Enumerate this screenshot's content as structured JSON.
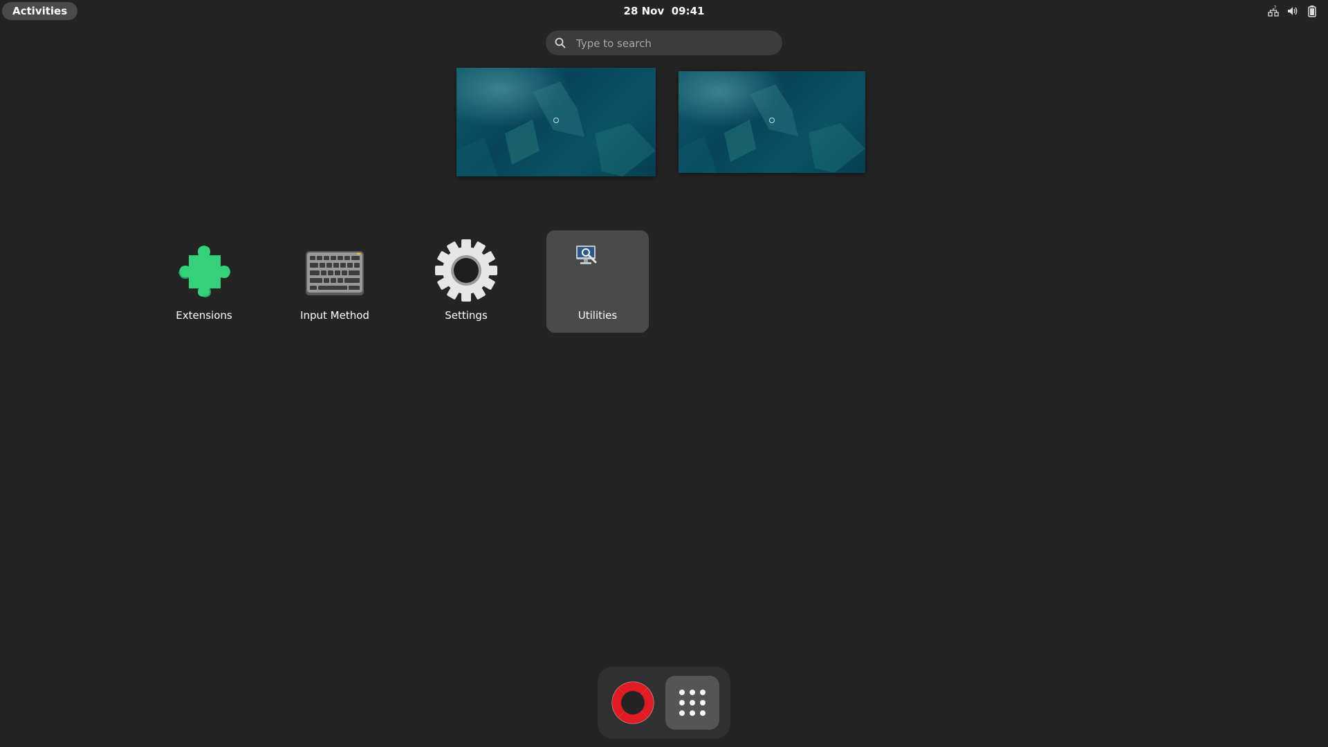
{
  "topbar": {
    "activities_label": "Activities",
    "clock": "28 Nov  09:41",
    "tray_icons": [
      "network-icon",
      "volume-icon",
      "battery-icon"
    ]
  },
  "search": {
    "placeholder": "Type to search",
    "value": ""
  },
  "workspaces": [
    {
      "name": "workspace-1"
    },
    {
      "name": "workspace-2"
    }
  ],
  "apps": [
    {
      "label": "Extensions",
      "icon": "puzzle-piece-icon",
      "color": "#33d17a"
    },
    {
      "label": "Input Method",
      "icon": "keyboard-icon",
      "color": "#9a9a9a"
    },
    {
      "label": "Settings",
      "icon": "gear-icon",
      "color": "#e0e0e0"
    },
    {
      "label": "Utilities",
      "icon": "utilities-folder-icon",
      "color": "#4a4a4a"
    }
  ],
  "dock": {
    "items": [
      {
        "icon": "help-lifebuoy-icon"
      },
      {
        "icon": "show-apps-grid-icon"
      }
    ]
  },
  "colors": {
    "background": "#242424",
    "accent_green": "#33d17a",
    "lifebuoy_red": "#e01b24",
    "wallpaper_teal": "#0a5264"
  }
}
